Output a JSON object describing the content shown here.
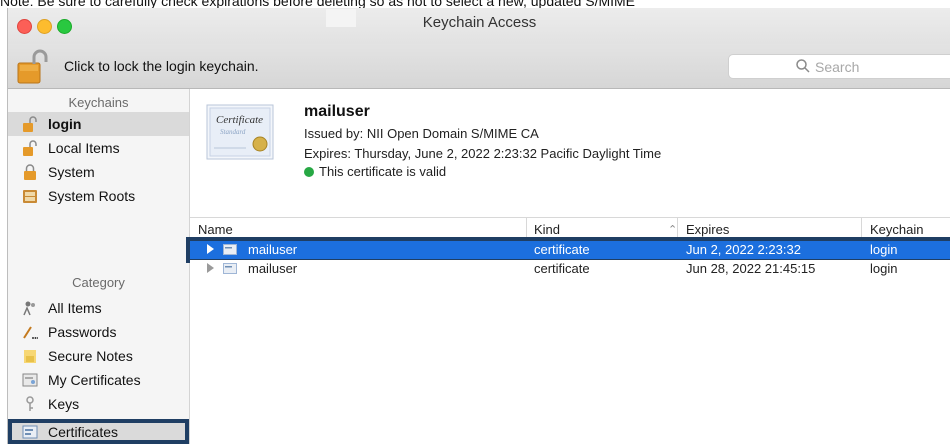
{
  "note": "Note: Be sure to carefully check expirations before deleting so as not to select a new, updated S/MIME",
  "window": {
    "title": "Keychain Access"
  },
  "toolbar": {
    "lock_label": "Click to lock the login keychain.",
    "search_placeholder": "Search"
  },
  "sidebar": {
    "keychains_header": "Keychains",
    "keychains": [
      {
        "label": "login",
        "icon": "lock-open-icon",
        "selected": true
      },
      {
        "label": "Local Items",
        "icon": "lock-open-icon"
      },
      {
        "label": "System",
        "icon": "lock-closed-icon"
      },
      {
        "label": "System Roots",
        "icon": "cabinet-icon"
      }
    ],
    "category_header": "Category",
    "categories": [
      {
        "label": "All Items",
        "icon": "people-icon"
      },
      {
        "label": "Passwords",
        "icon": "pencil-dots-icon"
      },
      {
        "label": "Secure Notes",
        "icon": "note-icon"
      },
      {
        "label": "My Certificates",
        "icon": "cert-badge-icon"
      },
      {
        "label": "Keys",
        "icon": "key-icon"
      },
      {
        "label": "Certificates",
        "icon": "certificate-icon",
        "selected": true
      }
    ]
  },
  "detail": {
    "name": "mailuser",
    "issued_by": "Issued by: NII Open Domain S/MIME CA",
    "expires": "Expires: Thursday, June 2, 2022 2:23:32 Pacific Daylight Time",
    "status": "This certificate is valid",
    "thumb_text": "Certificate",
    "thumb_sub": "Standard"
  },
  "table": {
    "columns": [
      "Name",
      "Kind",
      "Expires",
      "Keychain"
    ],
    "rows": [
      {
        "name": "mailuser",
        "kind": "certificate",
        "expires": "Jun 2, 2022 2:23:32",
        "keychain": "login",
        "selected": true
      },
      {
        "name": "mailuser",
        "kind": "certificate",
        "expires": "Jun 28, 2022 21:45:15",
        "keychain": "login"
      }
    ]
  },
  "colors": {
    "selection": "#1c6fde",
    "highlight_border": "#1f3e63",
    "valid": "#27a844"
  }
}
